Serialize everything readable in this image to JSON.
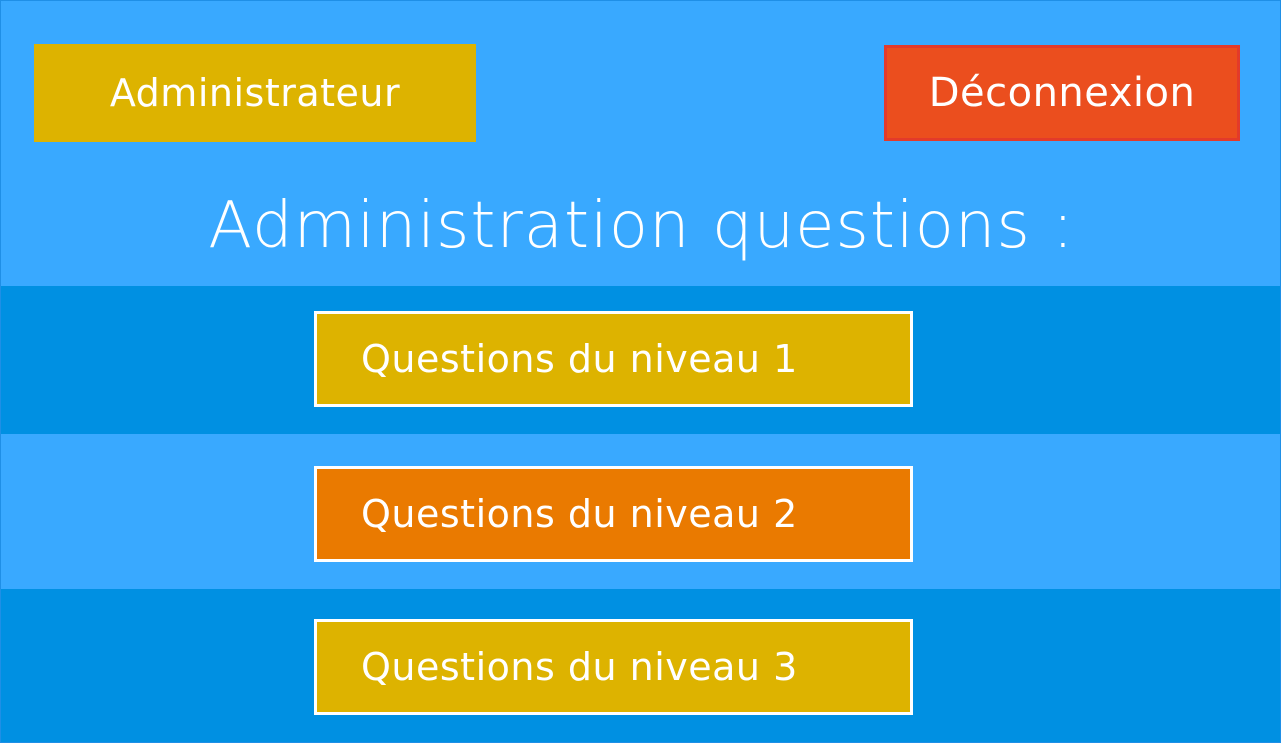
{
  "header": {
    "role_label": "Administrateur",
    "logout_label": "Déconnexion"
  },
  "main": {
    "title": "Administration questions :",
    "levels": [
      {
        "label": "Questions du niveau 1"
      },
      {
        "label": "Questions du niveau 2"
      },
      {
        "label": "Questions du niveau 3"
      }
    ]
  },
  "colors": {
    "background": "#39a9ff",
    "band_dark": "#0090e2",
    "gold": "#ddb300",
    "orange": "#ea7a00",
    "logout_red": "#eb4e1e",
    "text": "#ffffff"
  }
}
